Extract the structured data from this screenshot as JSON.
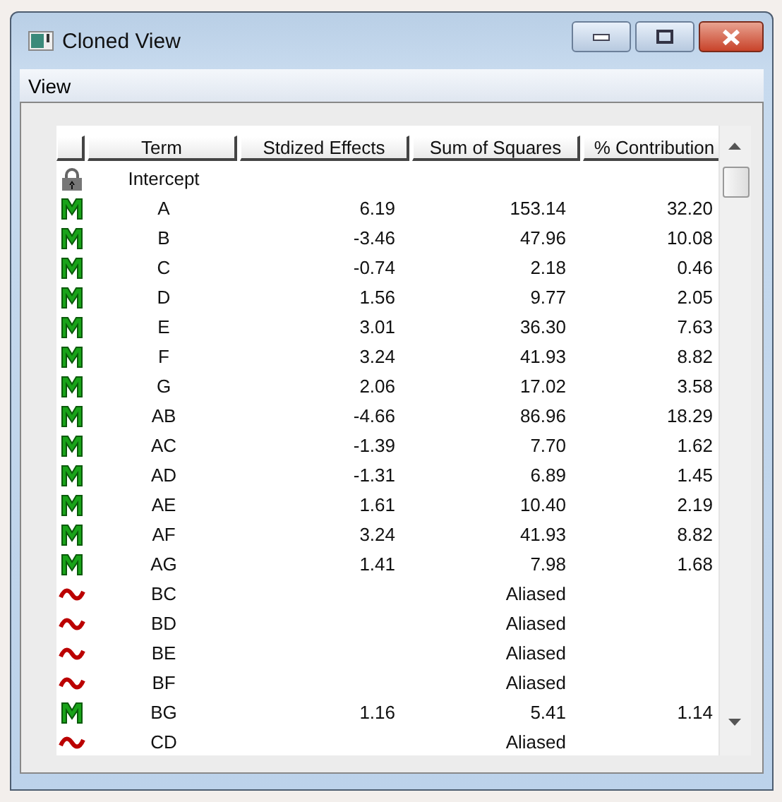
{
  "window": {
    "title": "Cloned View"
  },
  "menu": [
    "View"
  ],
  "table": {
    "columns": [
      "Term",
      "Stdized Effects",
      "Sum of Squares",
      "% Contribution"
    ],
    "rows": [
      {
        "kind": "intercept",
        "term": "Intercept"
      },
      {
        "kind": "model",
        "term": "A",
        "effect": "6.19",
        "ss": "153.14",
        "pct": "32.20"
      },
      {
        "kind": "model",
        "term": "B",
        "effect": "-3.46",
        "ss": "47.96",
        "pct": "10.08"
      },
      {
        "kind": "model",
        "term": "C",
        "effect": "-0.74",
        "ss": "2.18",
        "pct": "0.46"
      },
      {
        "kind": "model",
        "term": "D",
        "effect": "1.56",
        "ss": "9.77",
        "pct": "2.05"
      },
      {
        "kind": "model",
        "term": "E",
        "effect": "3.01",
        "ss": "36.30",
        "pct": "7.63"
      },
      {
        "kind": "model",
        "term": "F",
        "effect": "3.24",
        "ss": "41.93",
        "pct": "8.82"
      },
      {
        "kind": "model",
        "term": "G",
        "effect": "2.06",
        "ss": "17.02",
        "pct": "3.58"
      },
      {
        "kind": "model",
        "term": "AB",
        "effect": "-4.66",
        "ss": "86.96",
        "pct": "18.29"
      },
      {
        "kind": "model",
        "term": "AC",
        "effect": "-1.39",
        "ss": "7.70",
        "pct": "1.62"
      },
      {
        "kind": "model",
        "term": "AD",
        "effect": "-1.31",
        "ss": "6.89",
        "pct": "1.45"
      },
      {
        "kind": "model",
        "term": "AE",
        "effect": "1.61",
        "ss": "10.40",
        "pct": "2.19"
      },
      {
        "kind": "model",
        "term": "AF",
        "effect": "3.24",
        "ss": "41.93",
        "pct": "8.82"
      },
      {
        "kind": "model",
        "term": "AG",
        "effect": "1.41",
        "ss": "7.98",
        "pct": "1.68"
      },
      {
        "kind": "aliased",
        "term": "BC",
        "ss": "Aliased"
      },
      {
        "kind": "aliased",
        "term": "BD",
        "ss": "Aliased"
      },
      {
        "kind": "aliased",
        "term": "BE",
        "ss": "Aliased"
      },
      {
        "kind": "aliased",
        "term": "BF",
        "ss": "Aliased"
      },
      {
        "kind": "model",
        "term": "BG",
        "effect": "1.16",
        "ss": "5.41",
        "pct": "1.14"
      },
      {
        "kind": "aliased",
        "term": "CD",
        "ss": "Aliased"
      }
    ]
  }
}
